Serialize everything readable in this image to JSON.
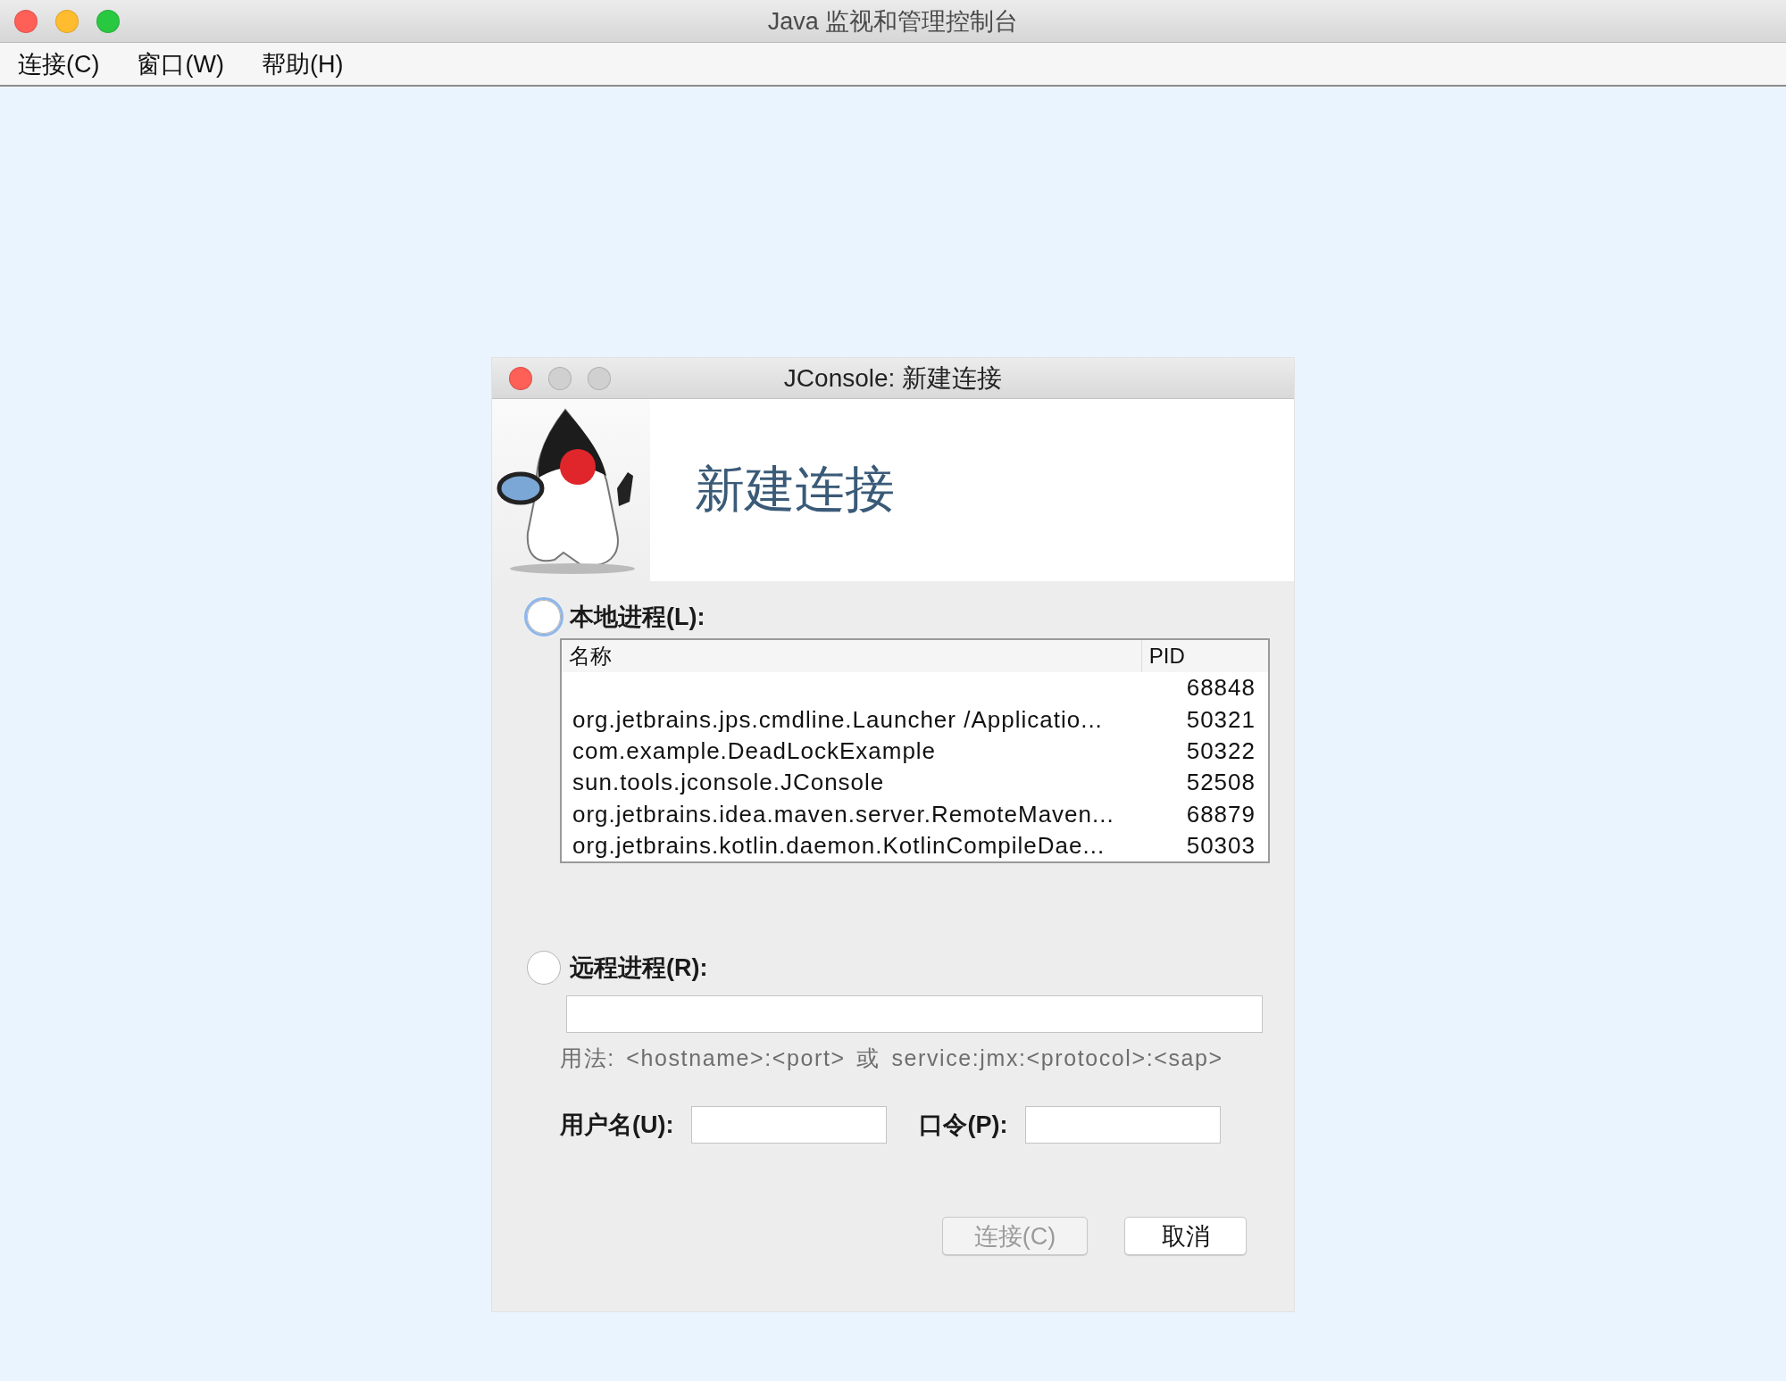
{
  "window": {
    "title": "Java 监视和管理控制台"
  },
  "menu": [
    "连接(C)",
    "窗口(W)",
    "帮助(H)"
  ],
  "dialog": {
    "title": "JConsole: 新建连接",
    "heading": "新建连接",
    "local": {
      "label": "本地进程(L):",
      "selected": false,
      "focused": true,
      "table": {
        "columns": [
          "名称",
          "PID"
        ],
        "rows": [
          {
            "pid": "68848"
          },
          {
            "name": "org.jetbrains.jps.cmdline.Launcher /Applicatio...",
            "pid": "50321"
          },
          {
            "name": "com.example.DeadLockExample",
            "pid": "50322"
          },
          {
            "name": "sun.tools.jconsole.JConsole",
            "pid": "52508"
          },
          {
            "name": "org.jetbrains.idea.maven.server.RemoteMaven...",
            "pid": "68879"
          },
          {
            "name": "org.jetbrains.kotlin.daemon.KotlinCompileDae...",
            "pid": "50303"
          }
        ]
      }
    },
    "remote": {
      "label": "远程进程(R):",
      "selected": false
    },
    "usage": "用法: <hostname>:<port> 或 service:jmx:<protocol>:<sap>",
    "username_label": "用户名(U):",
    "password_label": "口令(P):",
    "buttons": [
      {
        "label": "连接(C)",
        "disabled": true
      },
      {
        "label": "取消",
        "disabled": false
      }
    ]
  }
}
